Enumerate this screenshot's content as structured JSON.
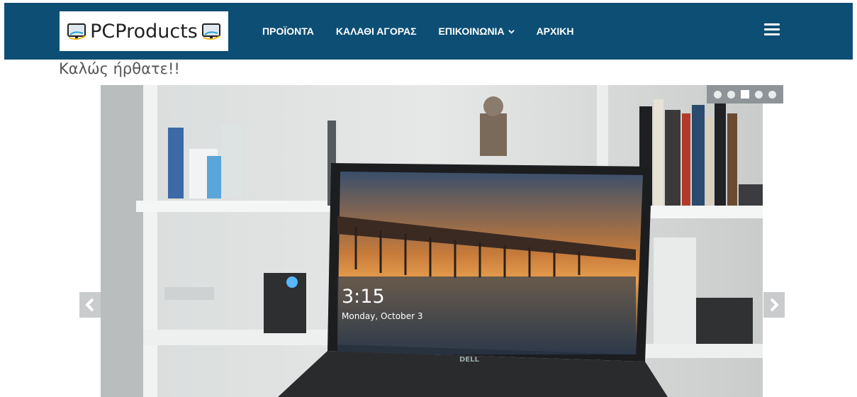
{
  "brand": {
    "logo_text": "PCProducts"
  },
  "nav": {
    "items": [
      {
        "label": "ΠΡΟΪΟΝΤΑ"
      },
      {
        "label": "ΚΑΛΑΘΙ ΑΓΟΡΑΣ"
      },
      {
        "label": "ΕΠΙΚΟΙΝΩΝΙΑ",
        "has_dropdown": true
      },
      {
        "label": "ΑΡΧΙΚΗ"
      }
    ],
    "menu_icon": "hamburger-icon",
    "background_color": "#0d4e74"
  },
  "welcome": {
    "text": "Καλώς ήρθατε!!"
  },
  "carousel": {
    "slide_count": 5,
    "active_index": 2,
    "prev_icon": "chevron-left-icon",
    "next_icon": "chevron-right-icon",
    "slide": {
      "screen_time": "3:15",
      "screen_date": "Monday, October 3",
      "laptop_brand": "DELL"
    }
  }
}
